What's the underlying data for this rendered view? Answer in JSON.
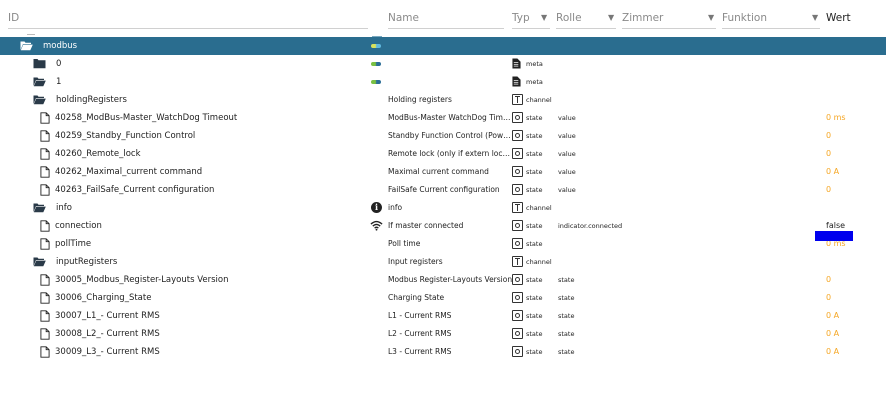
{
  "header": {
    "col_id": "ID",
    "col_name": "Name",
    "col_typ": "Typ",
    "col_rolle": "Rolle",
    "col_zimmer": "Zimmer",
    "col_funktion": "Funktion",
    "col_wert": "Wert"
  },
  "rows": [
    {
      "label": "modbus",
      "kind": "folder-open",
      "name": "",
      "type": "",
      "role": "",
      "value": ""
    },
    {
      "label": "0",
      "kind": "folder-closed",
      "name": "",
      "type": "meta",
      "role": "",
      "value": ""
    },
    {
      "label": "1",
      "kind": "folder-open",
      "name": "",
      "type": "meta",
      "role": "",
      "value": ""
    },
    {
      "label": "holdingRegisters",
      "kind": "folder-open",
      "name": "Holding registers",
      "type": "channel",
      "role": "",
      "value": ""
    },
    {
      "label": "40258_ModBus-Master_WatchDog Timeout",
      "kind": "file",
      "name": "ModBus-Master WatchDog Timeo...",
      "type": "state",
      "role": "value",
      "value": "0 ms"
    },
    {
      "label": "40259_Standby_Function Control",
      "kind": "file",
      "name": "Standby Function Control (Power ...",
      "type": "state",
      "role": "value",
      "value": "0"
    },
    {
      "label": "40260_Remote_lock",
      "kind": "file",
      "name": "Remote lock (only if extern lock un...",
      "type": "state",
      "role": "value",
      "value": "0"
    },
    {
      "label": "40262_Maximal_current command",
      "kind": "file",
      "name": "Maximal current command",
      "type": "state",
      "role": "value",
      "value": "0 A"
    },
    {
      "label": "40263_FailSafe_Current configuration",
      "kind": "file",
      "name": "FailSafe Current configuration",
      "type": "state",
      "role": "value",
      "value": "0"
    },
    {
      "label": "info",
      "kind": "folder-open",
      "name": "info",
      "type": "channel",
      "role": "",
      "value": ""
    },
    {
      "label": "connection",
      "kind": "file",
      "name": "If master connected",
      "type": "state",
      "role": "indicator.connected",
      "value": "false"
    },
    {
      "label": "pollTime",
      "kind": "file",
      "name": "Poll time",
      "type": "state",
      "role": "",
      "value": "0 ms"
    },
    {
      "label": "inputRegisters",
      "kind": "folder-open",
      "name": "Input registers",
      "type": "channel",
      "role": "",
      "value": ""
    },
    {
      "label": "30005_Modbus_Register-Layouts Version",
      "kind": "file",
      "name": "Modbus Register-Layouts Version",
      "type": "state",
      "role": "state",
      "value": "0"
    },
    {
      "label": "30006_Charging_State",
      "kind": "file",
      "name": "Charging State",
      "type": "state",
      "role": "state",
      "value": "0"
    },
    {
      "label": "30007_L1_- Current RMS",
      "kind": "file",
      "name": "L1 - Current RMS",
      "type": "state",
      "role": "state",
      "value": "0 A"
    },
    {
      "label": "30008_L2_- Current RMS",
      "kind": "file",
      "name": "L2 - Current RMS",
      "type": "state",
      "role": "state",
      "value": "0 A"
    },
    {
      "label": "30009_L3_- Current RMS",
      "kind": "file",
      "name": "L3 - Current RMS",
      "type": "state",
      "role": "state",
      "value": "0 A"
    }
  ],
  "colors": {
    "selected_row": "#2a6d8f",
    "value_orange": "#f5a623",
    "highlight_blue": "#0000ee"
  }
}
